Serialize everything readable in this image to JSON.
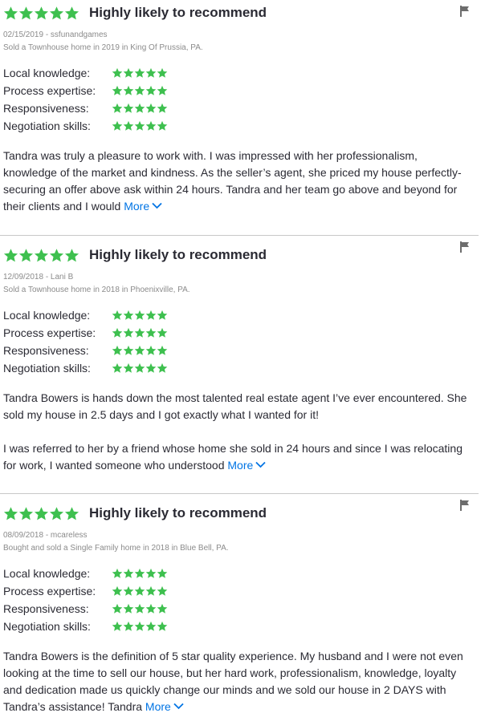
{
  "colors": {
    "star": "#3ec04f",
    "link": "#0074e4",
    "flag": "#6d6d6d"
  },
  "icons": {
    "star": "star-icon",
    "flag": "flag-icon",
    "chevron": "chevron-down-icon"
  },
  "rating_labels": [
    "Local knowledge:",
    "Process expertise:",
    "Responsiveness:",
    "Negotiation skills:"
  ],
  "more_label": "More",
  "reviews": [
    {
      "stars": 5,
      "headline": "Highly likely to recommend",
      "date_author": "02/15/2019 - ssfunandgames",
      "transaction": "Sold a Townhouse home in 2019 in King Of Prussia, PA.",
      "ratings": [
        5,
        5,
        5,
        5
      ],
      "paragraphs": [
        "Tandra was truly a pleasure to work with. I was impressed with her professionalism, knowledge of the market and kindness. As the seller’s agent, she priced my house perfectly- securing an offer above ask within 24 hours. Tandra and her team go above and beyond for their clients and I would"
      ]
    },
    {
      "stars": 5,
      "headline": "Highly likely to recommend",
      "date_author": "12/09/2018 - Lani B",
      "transaction": "Sold a Townhouse home in 2018 in Phoenixville, PA.",
      "ratings": [
        5,
        5,
        5,
        5
      ],
      "paragraphs": [
        "Tandra Bowers is hands down the most talented real estate agent I’ve ever encountered. She sold my house in 2.5 days and I got exactly what I wanted for it!",
        "I was referred to her by a friend whose home she sold in 24 hours and since I was relocating for work, I wanted someone who understood"
      ]
    },
    {
      "stars": 5,
      "headline": "Highly likely to recommend",
      "date_author": "08/09/2018 - mcareless",
      "transaction": "Bought and sold a Single Family home in 2018 in Blue Bell, PA.",
      "ratings": [
        5,
        5,
        5,
        5
      ],
      "paragraphs": [
        "Tandra Bowers is the definition of 5 star quality experience. My husband and I were not even looking at the time to sell our house, but her hard work, professionalism, knowledge, loyalty and dedication made us quickly change our minds and we sold our house in 2 DAYS with Tandra’s assistance! Tandra"
      ]
    }
  ]
}
